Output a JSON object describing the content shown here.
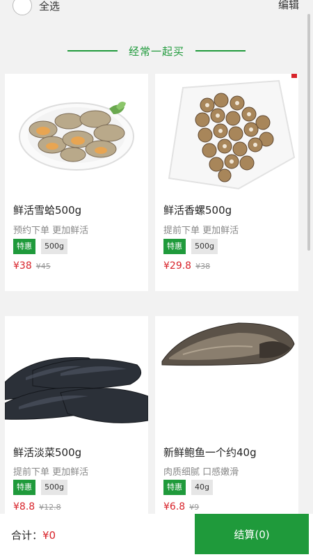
{
  "header": {
    "select_all": "全选",
    "edit": "编辑"
  },
  "section": {
    "title": "经常一起买"
  },
  "products": [
    {
      "name": "鲜活雪蛤500g",
      "desc": "预约下单 更加鲜活",
      "tag": "特惠",
      "spec": "500g",
      "price": "¥38",
      "orig_price": "¥45"
    },
    {
      "name": "鲜活香螺500g",
      "desc": "提前下单 更加鲜活",
      "tag": "特惠",
      "spec": "500g",
      "price": "¥29.8",
      "orig_price": "¥38"
    },
    {
      "name": "鲜活淡菜500g",
      "desc": "提前下单 更加鲜活",
      "tag": "特惠",
      "spec": "500g",
      "price": "¥8.8",
      "orig_price": "¥12.8"
    },
    {
      "name": "新鲜鲍鱼一个约40g",
      "desc": "肉质细腻 口感嫩滑",
      "tag": "特惠",
      "spec": "40g",
      "price": "¥6.8",
      "orig_price": "¥9"
    }
  ],
  "footer": {
    "total_label": "合计：",
    "total_value": "¥0",
    "checkout": "结算(0)"
  },
  "colors": {
    "brand": "#1f9a3b",
    "price": "#d8232a"
  }
}
